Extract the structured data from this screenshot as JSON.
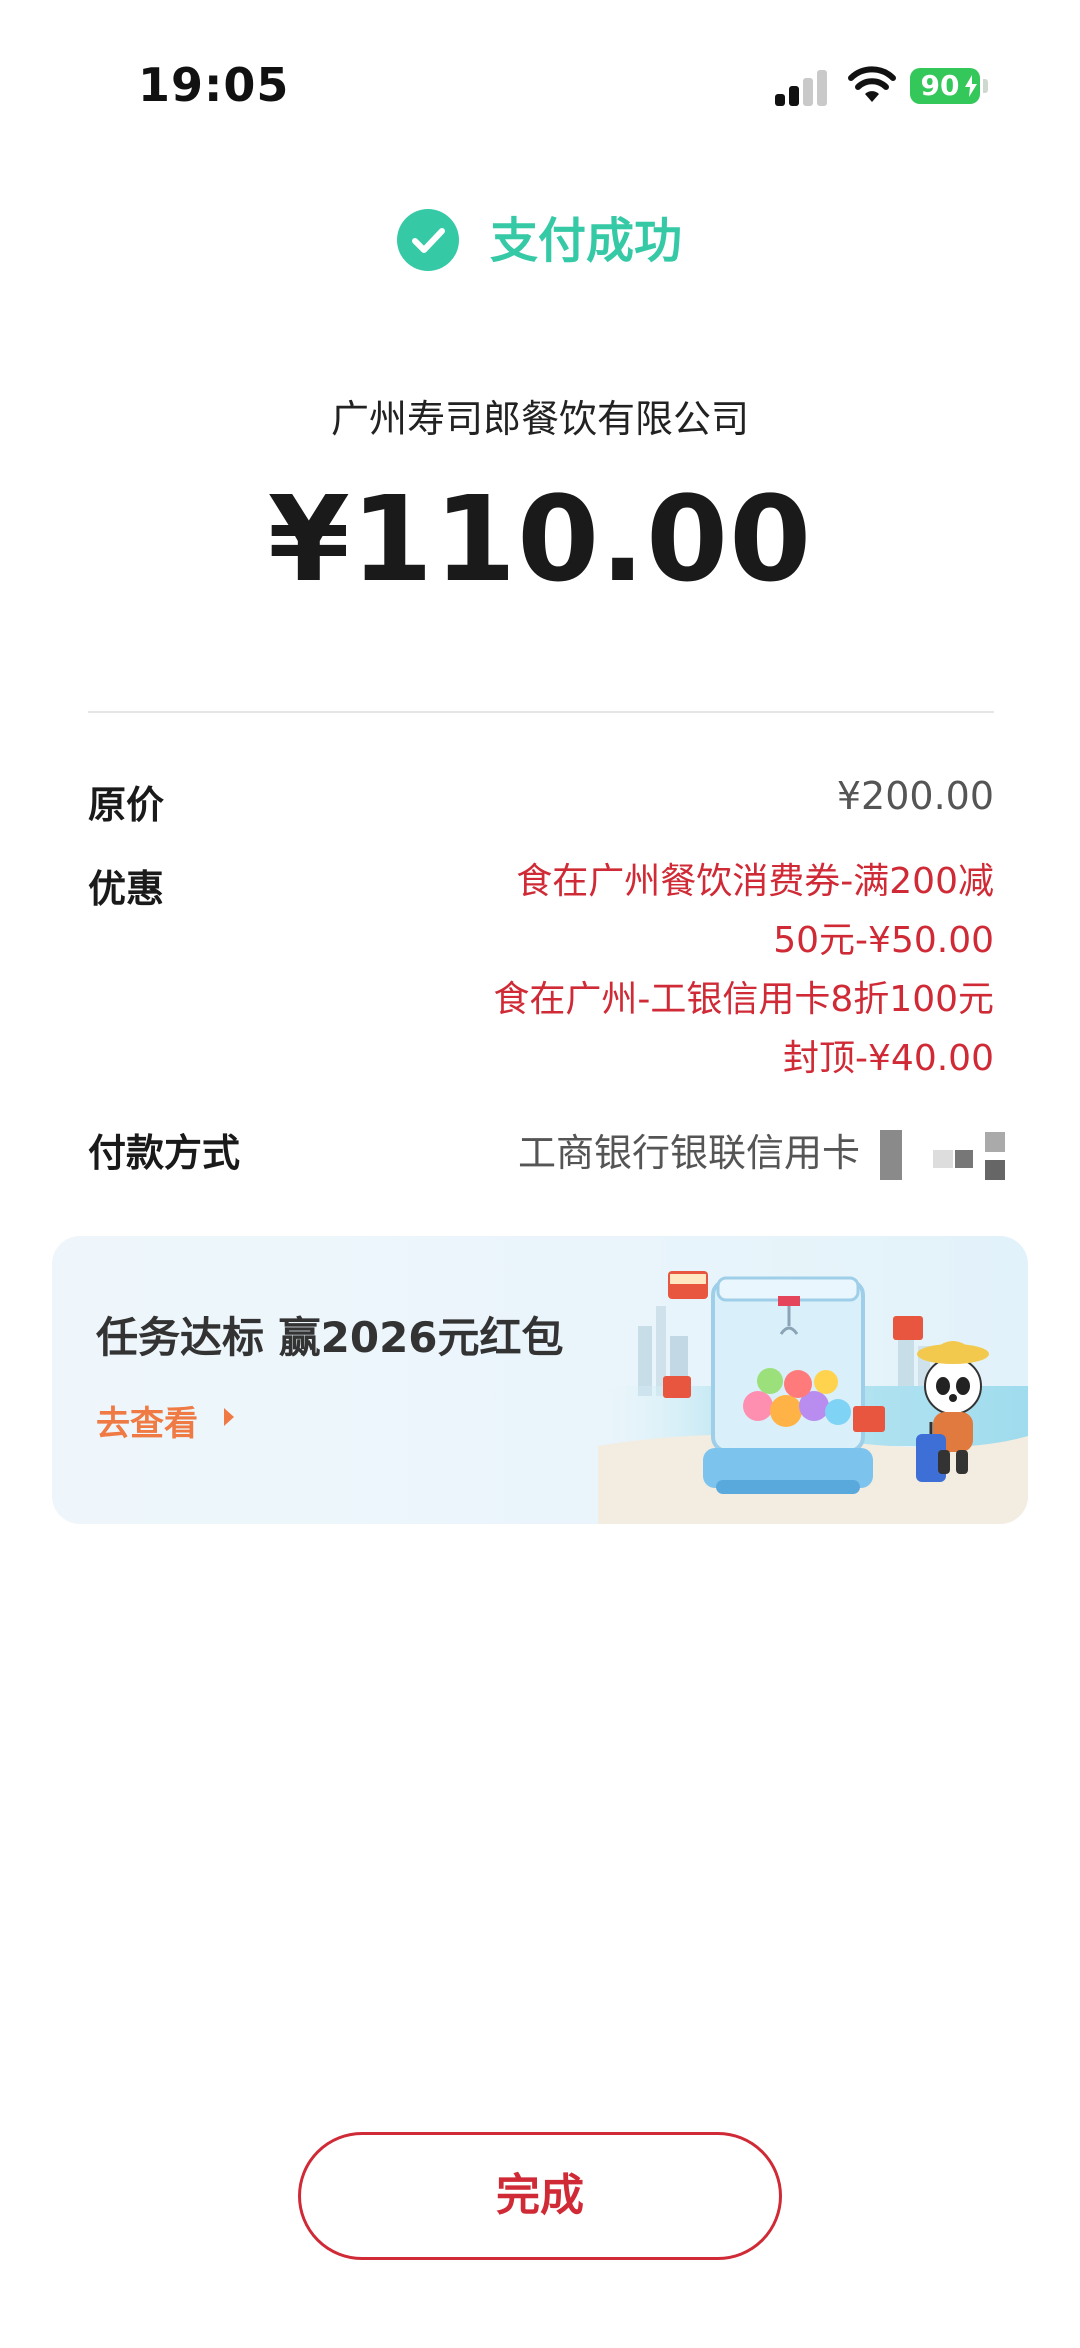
{
  "status_bar": {
    "time": "19:05",
    "battery_percent": "90",
    "battery_color": "#34c759"
  },
  "header": {
    "success_icon": "checkmark-circle-icon",
    "success_text": "支付成功",
    "accent_color": "#36c9a6"
  },
  "payment": {
    "merchant": "广州寿司郎餐饮有限公司",
    "amount": "¥110.00"
  },
  "details": {
    "original_price_label": "原价",
    "original_price_value": "¥200.00",
    "discount_label": "优惠",
    "discount_lines": [
      "食在广州餐饮消费券-满200减",
      "50元-¥50.00",
      "食在广州-工银信用卡8折100元",
      "封顶-¥40.00"
    ],
    "discount_color": "#cf2a35",
    "payment_method_label": "付款方式",
    "payment_method_value": "工商银行银联信用卡"
  },
  "banner": {
    "title": "任务达标 赢2026元红包",
    "cta": "去查看",
    "cta_icon": "triangle-right-icon",
    "cta_color": "#ef7a43",
    "illustration": "claw-machine-panda-illustration"
  },
  "footer": {
    "done_label": "完成",
    "button_color": "#cf2a35"
  }
}
